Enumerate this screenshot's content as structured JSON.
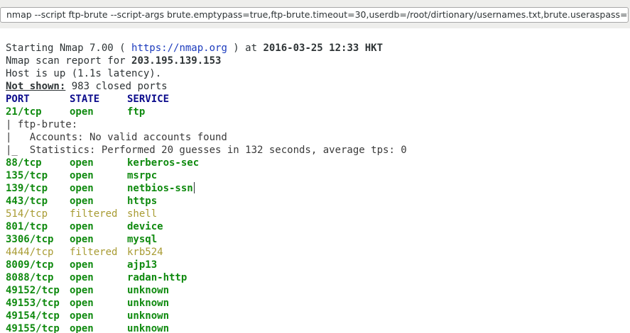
{
  "command": "nmap --script ftp-brute --script-args brute.emptypass=true,ftp-brute.timeout=30,userdb=/root/dirtionary/usernames.txt,brute.useraspass=true",
  "header": {
    "start_prefix": "Starting Nmap 7.00 ( ",
    "url": "https://nmap.org",
    "start_mid": " ) at ",
    "datetime": "2016-03-25 12:33 HKT",
    "report_prefix": "Nmap scan report for ",
    "ip": "203.195.139.153",
    "host_up": "Host is up (1.1s latency).",
    "not_shown_label": "Not shown:",
    "not_shown_value": " 983 closed ports"
  },
  "table": {
    "headers": {
      "port": "PORT",
      "state": "STATE",
      "service": "SERVICE"
    },
    "rows": [
      {
        "port": "21/tcp",
        "state": "open",
        "service": "ftp",
        "status": "open"
      },
      {
        "port": "88/tcp",
        "state": "open",
        "service": "kerberos-sec",
        "status": "open"
      },
      {
        "port": "135/tcp",
        "state": "open",
        "service": "msrpc",
        "status": "open"
      },
      {
        "port": "139/tcp",
        "state": "open",
        "service": "netbios-ssn",
        "status": "open"
      },
      {
        "port": "443/tcp",
        "state": "open",
        "service": "https",
        "status": "open"
      },
      {
        "port": "514/tcp",
        "state": "filtered",
        "service": "shell",
        "status": "filtered"
      },
      {
        "port": "801/tcp",
        "state": "open",
        "service": "device",
        "status": "open"
      },
      {
        "port": "3306/tcp",
        "state": "open",
        "service": "mysql",
        "status": "open"
      },
      {
        "port": "4444/tcp",
        "state": "filtered",
        "service": "krb524",
        "status": "filtered"
      },
      {
        "port": "8009/tcp",
        "state": "open",
        "service": "ajp13",
        "status": "open"
      },
      {
        "port": "8088/tcp",
        "state": "open",
        "service": "radan-http",
        "status": "open"
      },
      {
        "port": "49152/tcp",
        "state": "open",
        "service": "unknown",
        "status": "open"
      },
      {
        "port": "49153/tcp",
        "state": "open",
        "service": "unknown",
        "status": "open"
      },
      {
        "port": "49154/tcp",
        "state": "open",
        "service": "unknown",
        "status": "open"
      },
      {
        "port": "49155/tcp",
        "state": "open",
        "service": "unknown",
        "status": "open"
      }
    ]
  },
  "script_output": {
    "line1": "| ftp-brute:",
    "line2": "|   Accounts: No valid accounts found",
    "line3": "|_  Statistics: Performed 20 guesses in 132 seconds, average tps: 0"
  },
  "colors": {
    "open": "#0f8a0f",
    "filtered": "#a89b32",
    "header": "#0c0c8c",
    "link": "#1c3bbd"
  }
}
